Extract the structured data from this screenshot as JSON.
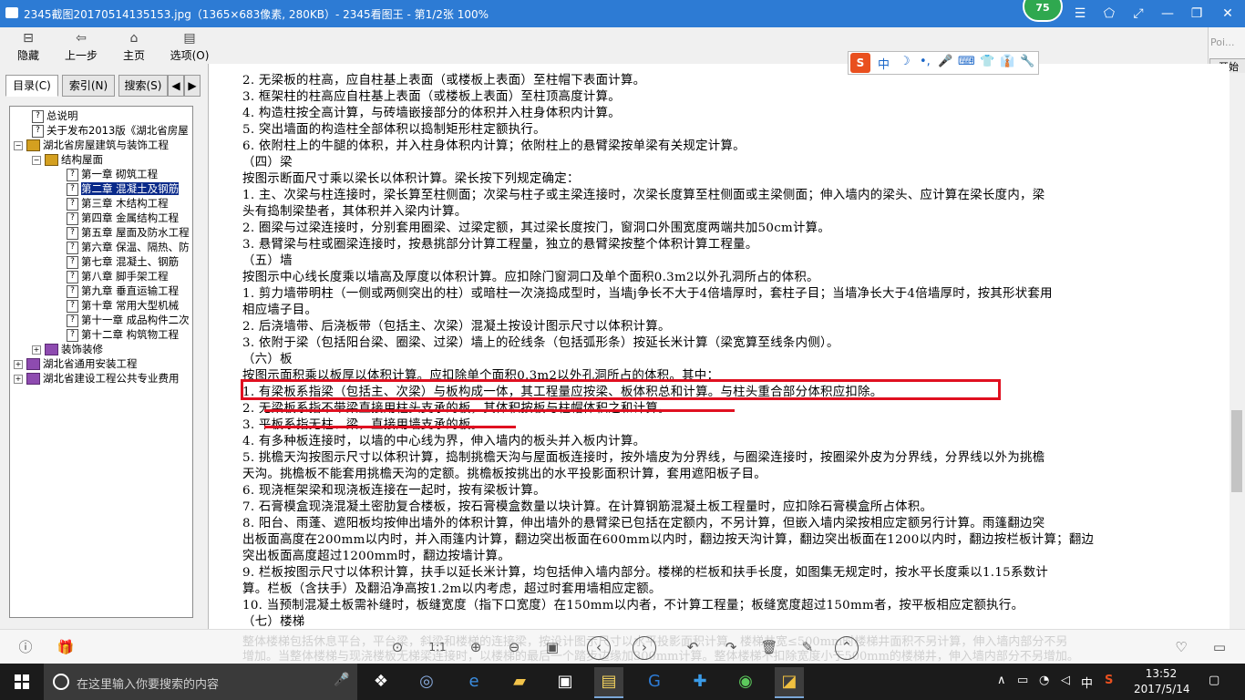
{
  "viewer": {
    "title": "2345截图20170514135153.jpg（1365×683像素, 280KB）- 2345看图王 - 第1/2张 100%",
    "badge": "75",
    "controls": [
      "☰",
      "⬠",
      "⤢",
      "—",
      "❐",
      "✕"
    ]
  },
  "help_toolbar": {
    "hide": "隐藏",
    "back": "上一步",
    "home": "主页",
    "options": "选项(O)"
  },
  "right_strip": {
    "poi": "Poi...",
    "start": "开始"
  },
  "sidebar": {
    "tabs": [
      "目录(C)",
      "索引(N)",
      "搜索(S)"
    ],
    "tree": [
      {
        "label": "总说明",
        "icon": "q"
      },
      {
        "label": "关于发布2013版《湖北省房屋",
        "icon": "q"
      },
      {
        "label": "湖北省房屋建筑与装饰工程",
        "icon": "book"
      },
      {
        "label": "结构屋面",
        "icon": "book"
      },
      {
        "label": "第一章 砌筑工程",
        "icon": "q"
      },
      {
        "label": "第二章 混凝土及钢筋",
        "icon": "q"
      },
      {
        "label": "第三章 木结构工程",
        "icon": "q"
      },
      {
        "label": "第四章 金属结构工程",
        "icon": "q"
      },
      {
        "label": "第五章 屋面及防水工程",
        "icon": "q"
      },
      {
        "label": "第六章 保温、隔热、防",
        "icon": "q"
      },
      {
        "label": "第七章 混凝土、钢筋",
        "icon": "q"
      },
      {
        "label": "第八章 脚手架工程",
        "icon": "q"
      },
      {
        "label": "第九章 垂直运输工程",
        "icon": "q"
      },
      {
        "label": "第十章 常用大型机械",
        "icon": "q"
      },
      {
        "label": "第十一章 成品构件二次",
        "icon": "q"
      },
      {
        "label": "第十二章 构筑物工程",
        "icon": "q"
      },
      {
        "label": "装饰装修",
        "icon": "book-p"
      },
      {
        "label": "湖北省通用安装工程",
        "icon": "book-p"
      },
      {
        "label": "湖北省建设工程公共专业费用",
        "icon": "book-p"
      }
    ]
  },
  "content": {
    "lines": [
      "2. 无梁板的柱高，应自柱基上表面（或楼板上表面）至柱帽下表面计算。",
      "3. 框架柱的柱高应自柱基上表面（或楼板上表面）至柱顶高度计算。",
      "4. 构造柱按全高计算，与砖墙嵌接部分的体积并入柱身体积内计算。",
      "5. 突出墙面的构造柱全部体积以捣制矩形柱定额执行。",
      "6. 依附柱上的牛腿的体积，并入柱身体积内计算；依附柱上的悬臂梁按单梁有关规定计算。",
      "（四）梁",
      "按图示断面尺寸乘以梁长以体积计算。梁长按下列规定确定：",
      "1. 主、次梁与柱连接时，梁长算至柱侧面；次梁与柱子或主梁连接时，次梁长度算至柱侧面或主梁侧面；伸入墙内的梁头、应计算在梁长度内，梁",
      "头有捣制梁垫者，其体积并入梁内计算。",
      "2. 圈梁与过梁连接时，分别套用圈梁、过梁定额，其过梁长度按门，窗洞口外围宽度两端共加50cm计算。",
      "3. 悬臂梁与柱或圈梁连接时，按悬挑部分计算工程量，独立的悬臂梁按整个体积计算工程量。",
      "（五）墙",
      "按图示中心线长度乘以墙高及厚度以体积计算。应扣除门窗洞口及单个面积0.3m2以外孔洞所占的体积。",
      "1. 剪力墙带明柱（一侧或两侧突出的柱）或暗柱一次浇捣成型时，当墙j争长不大于4倍墙厚时，套柱子目；当墙净长大于4倍墙厚时，按其形状套用",
      "相应墙子目。",
      "2. 后浇墙带、后浇板带（包括主、次梁）混凝土按设计图示尺寸以体积计算。",
      "3. 依附于梁（包括阳台梁、圈梁、过梁）墙上的砼线条（包括弧形条）按延长米计算（梁宽算至线条内侧）。",
      "（六）板",
      "按图示面积乘以板厚以体积计算。应扣除单个面积0.3m2以外孔洞所占的体积。其中：",
      "1. 有梁板系指梁（包括主、次梁）与板构成一体，其工程量应按梁、板体积总和计算。与柱头重合部分体积应扣除。",
      "2. 无梁板系指不带梁直接用柱头支承的板，其体积按板与柱帽体积之和计算。",
      "3. 平板系指无柱、梁，直接用墙支承的板。",
      "4. 有多种板连接时，以墙的中心线为界，伸入墙内的板头并入板内计算。",
      "5. 挑檐天沟按图示尺寸以体积计算，捣制挑檐天沟与屋面板连接时，按外墙皮为分界线，与圈梁连接时，按圈梁外皮为分界线，分界线以外为挑檐",
      "天沟。挑檐板不能套用挑檐天沟的定额。挑檐板按挑出的水平投影面积计算，套用遮阳板子目。",
      "6. 现浇框架梁和现浇板连接在一起时，按有梁板计算。",
      "7. 石膏模盒现浇混凝土密肋复合楼板，按石膏模盒数量以块计算。在计算钢筋混凝土板工程量时，应扣除石膏模盒所占体积。",
      "8. 阳台、雨蓬、遮阳板均按伸出墙外的体积计算，伸出墙外的悬臂梁已包括在定额内，不另计算，但嵌入墙内梁按相应定额另行计算。雨篷翻边突",
      "出板面高度在200mm以内时，并入雨篷内计算，翻边突出板面在600mm以内时，翻边按天沟计算，翻边突出板面在1200以内时，翻边按栏板计算；翻边",
      "突出板面高度超过1200mm时，翻边按墙计算。",
      "9. 栏板按图示尺寸以体积计算，扶手以延长米计算，均包括伸入墙内部分。楼梯的栏板和扶手长度，如图集无规定时，按水平长度乘以1.15系数计",
      "算。栏板（含扶手）及翻沿净高按1.2m以内考虑，超过时套用墙相应定额。",
      "10. 当预制混凝土板需补缝时，板缝宽度（指下口宽度）在150mm以内者，不计算工程量；板缝宽度超过150mm者，按平板相应定额执行。",
      "（七）楼梯"
    ],
    "ghost_lines": [
      "整体楼梯包括休息平台，平台梁，斜梁和楼梯的连接梁，按设计图示尺寸以水平投影面积计算，楼梯井宽≤500mm时楼梯井面积不另计算，伸入墙内部分不另",
      "增加。当整体楼梯与现浇楼板无梯梁连接时，以楼梯的最后一个踏步边缘加300mm计算。整体楼梯不扣除宽度小于500mm的楼梯井，伸入墙内部分不另增加。"
    ]
  },
  "ime": {
    "brand": "S",
    "items": [
      "中",
      "☽",
      "•,",
      "🎤",
      "⌨",
      "👕",
      "👔",
      "🔧"
    ]
  },
  "viewer_bottom": {
    "info": "ⓘ",
    "gift": "🎁",
    "ratio": "1:1",
    "buttons": [
      "⊙",
      "1:1",
      "⊕",
      "⊖",
      "▣",
      "‹",
      "›",
      "↶",
      "↷",
      "🗑",
      "✎",
      "⌃"
    ],
    "heart": "♡",
    "folder": "▭"
  },
  "taskbar": {
    "search_placeholder": "在这里输入你要搜索的内容",
    "ime_tray": "中",
    "time": "13:52",
    "date": "2017/5/14"
  },
  "colors": {
    "titlebar": "#2d7bd4",
    "highlight": "#e01020",
    "selection": "#0a2a8a",
    "taskbar": "#1b1b1b"
  }
}
